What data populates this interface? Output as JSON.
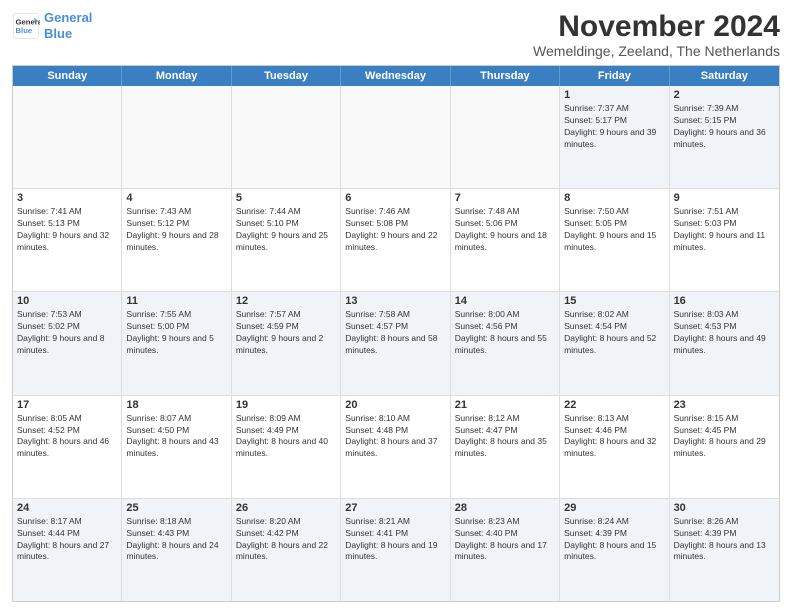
{
  "logo": {
    "line1": "General",
    "line2": "Blue"
  },
  "title": "November 2024",
  "location": "Wemeldinge, Zeeland, The Netherlands",
  "headers": [
    "Sunday",
    "Monday",
    "Tuesday",
    "Wednesday",
    "Thursday",
    "Friday",
    "Saturday"
  ],
  "rows": [
    [
      {
        "day": "",
        "info": ""
      },
      {
        "day": "",
        "info": ""
      },
      {
        "day": "",
        "info": ""
      },
      {
        "day": "",
        "info": ""
      },
      {
        "day": "",
        "info": ""
      },
      {
        "day": "1",
        "info": "Sunrise: 7:37 AM\nSunset: 5:17 PM\nDaylight: 9 hours and 39 minutes."
      },
      {
        "day": "2",
        "info": "Sunrise: 7:39 AM\nSunset: 5:15 PM\nDaylight: 9 hours and 36 minutes."
      }
    ],
    [
      {
        "day": "3",
        "info": "Sunrise: 7:41 AM\nSunset: 5:13 PM\nDaylight: 9 hours and 32 minutes."
      },
      {
        "day": "4",
        "info": "Sunrise: 7:43 AM\nSunset: 5:12 PM\nDaylight: 9 hours and 28 minutes."
      },
      {
        "day": "5",
        "info": "Sunrise: 7:44 AM\nSunset: 5:10 PM\nDaylight: 9 hours and 25 minutes."
      },
      {
        "day": "6",
        "info": "Sunrise: 7:46 AM\nSunset: 5:08 PM\nDaylight: 9 hours and 22 minutes."
      },
      {
        "day": "7",
        "info": "Sunrise: 7:48 AM\nSunset: 5:06 PM\nDaylight: 9 hours and 18 minutes."
      },
      {
        "day": "8",
        "info": "Sunrise: 7:50 AM\nSunset: 5:05 PM\nDaylight: 9 hours and 15 minutes."
      },
      {
        "day": "9",
        "info": "Sunrise: 7:51 AM\nSunset: 5:03 PM\nDaylight: 9 hours and 11 minutes."
      }
    ],
    [
      {
        "day": "10",
        "info": "Sunrise: 7:53 AM\nSunset: 5:02 PM\nDaylight: 9 hours and 8 minutes."
      },
      {
        "day": "11",
        "info": "Sunrise: 7:55 AM\nSunset: 5:00 PM\nDaylight: 9 hours and 5 minutes."
      },
      {
        "day": "12",
        "info": "Sunrise: 7:57 AM\nSunset: 4:59 PM\nDaylight: 9 hours and 2 minutes."
      },
      {
        "day": "13",
        "info": "Sunrise: 7:58 AM\nSunset: 4:57 PM\nDaylight: 8 hours and 58 minutes."
      },
      {
        "day": "14",
        "info": "Sunrise: 8:00 AM\nSunset: 4:56 PM\nDaylight: 8 hours and 55 minutes."
      },
      {
        "day": "15",
        "info": "Sunrise: 8:02 AM\nSunset: 4:54 PM\nDaylight: 8 hours and 52 minutes."
      },
      {
        "day": "16",
        "info": "Sunrise: 8:03 AM\nSunset: 4:53 PM\nDaylight: 8 hours and 49 minutes."
      }
    ],
    [
      {
        "day": "17",
        "info": "Sunrise: 8:05 AM\nSunset: 4:52 PM\nDaylight: 8 hours and 46 minutes."
      },
      {
        "day": "18",
        "info": "Sunrise: 8:07 AM\nSunset: 4:50 PM\nDaylight: 8 hours and 43 minutes."
      },
      {
        "day": "19",
        "info": "Sunrise: 8:09 AM\nSunset: 4:49 PM\nDaylight: 8 hours and 40 minutes."
      },
      {
        "day": "20",
        "info": "Sunrise: 8:10 AM\nSunset: 4:48 PM\nDaylight: 8 hours and 37 minutes."
      },
      {
        "day": "21",
        "info": "Sunrise: 8:12 AM\nSunset: 4:47 PM\nDaylight: 8 hours and 35 minutes."
      },
      {
        "day": "22",
        "info": "Sunrise: 8:13 AM\nSunset: 4:46 PM\nDaylight: 8 hours and 32 minutes."
      },
      {
        "day": "23",
        "info": "Sunrise: 8:15 AM\nSunset: 4:45 PM\nDaylight: 8 hours and 29 minutes."
      }
    ],
    [
      {
        "day": "24",
        "info": "Sunrise: 8:17 AM\nSunset: 4:44 PM\nDaylight: 8 hours and 27 minutes."
      },
      {
        "day": "25",
        "info": "Sunrise: 8:18 AM\nSunset: 4:43 PM\nDaylight: 8 hours and 24 minutes."
      },
      {
        "day": "26",
        "info": "Sunrise: 8:20 AM\nSunset: 4:42 PM\nDaylight: 8 hours and 22 minutes."
      },
      {
        "day": "27",
        "info": "Sunrise: 8:21 AM\nSunset: 4:41 PM\nDaylight: 8 hours and 19 minutes."
      },
      {
        "day": "28",
        "info": "Sunrise: 8:23 AM\nSunset: 4:40 PM\nDaylight: 8 hours and 17 minutes."
      },
      {
        "day": "29",
        "info": "Sunrise: 8:24 AM\nSunset: 4:39 PM\nDaylight: 8 hours and 15 minutes."
      },
      {
        "day": "30",
        "info": "Sunrise: 8:26 AM\nSunset: 4:39 PM\nDaylight: 8 hours and 13 minutes."
      }
    ]
  ]
}
